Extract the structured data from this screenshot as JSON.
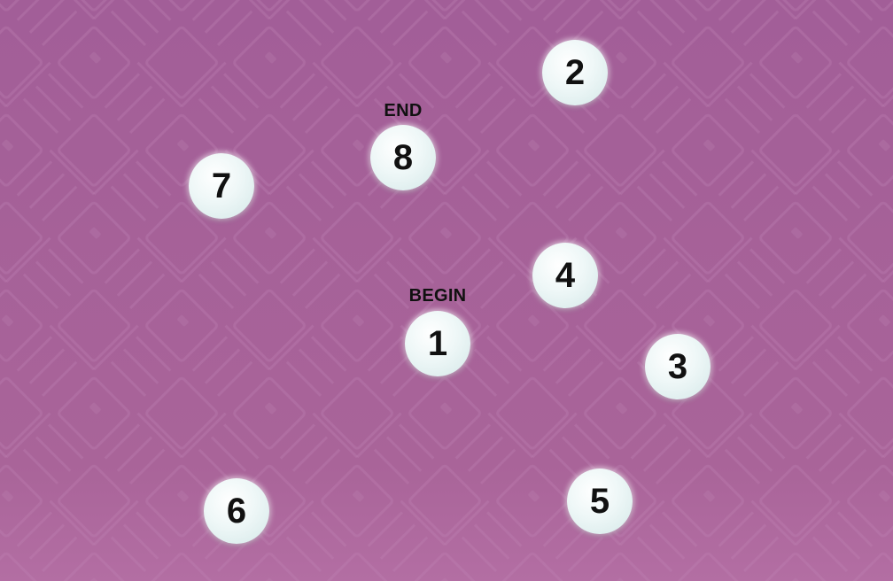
{
  "colors": {
    "background": "#a8629a",
    "pattern": "#b97aae",
    "dot_fill": "#eef7f7",
    "number_text": "#111111"
  },
  "labels": {
    "begin": "BEGIN",
    "end": "END"
  },
  "dots": [
    {
      "number": "1"
    },
    {
      "number": "2"
    },
    {
      "number": "3"
    },
    {
      "number": "4"
    },
    {
      "number": "5"
    },
    {
      "number": "6"
    },
    {
      "number": "7"
    },
    {
      "number": "8"
    }
  ]
}
